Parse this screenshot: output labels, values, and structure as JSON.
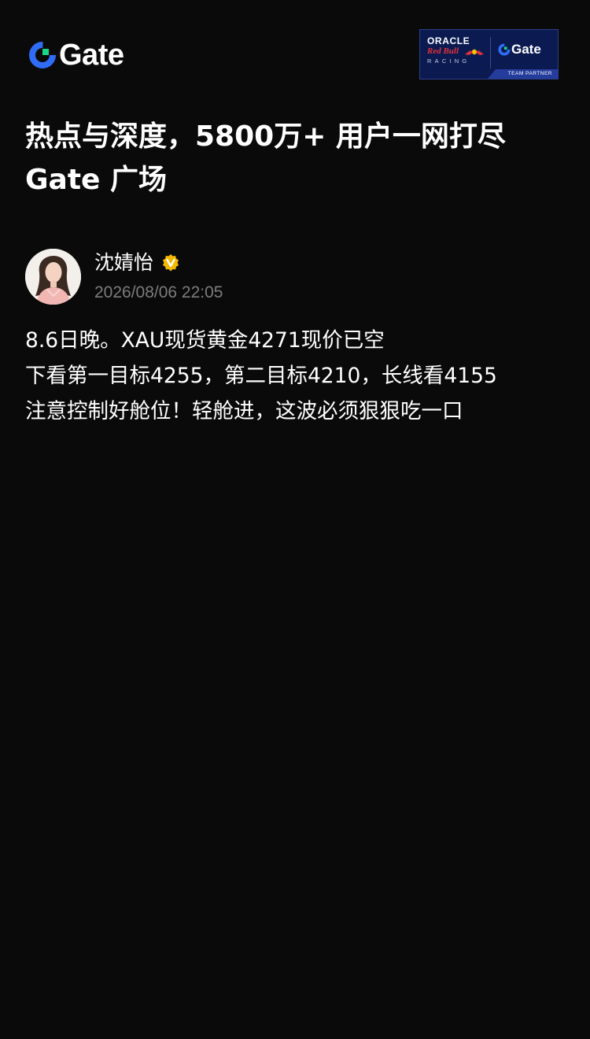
{
  "brand": {
    "logo_text": "Gate",
    "accent_color": "#2f6df6",
    "logo_icon": "gate-logo-icon"
  },
  "partner_badge": {
    "oracle": "ORACLE",
    "red_bull": "Red Bull",
    "racing": "RACING",
    "gate": "Gate",
    "team_partner": "TEAM PARTNER",
    "background": "#0b1b52"
  },
  "headline": {
    "line1": "热点与深度，5800万+ 用户一网打尽",
    "line2": "Gate 广场"
  },
  "post": {
    "author": {
      "name": "沈婧怡",
      "verified_icon": "verified-badge-icon",
      "verified_color": "#f5b800"
    },
    "timestamp": "2026/08/06 22:05",
    "body": [
      "8.6日晚。XAU现货黄金4271现价已空",
      "下看第一目标4255，第二目标4210，长线看4155",
      "注意控制好舱位！轻舱进，这波必须狠狠吃一口"
    ]
  }
}
